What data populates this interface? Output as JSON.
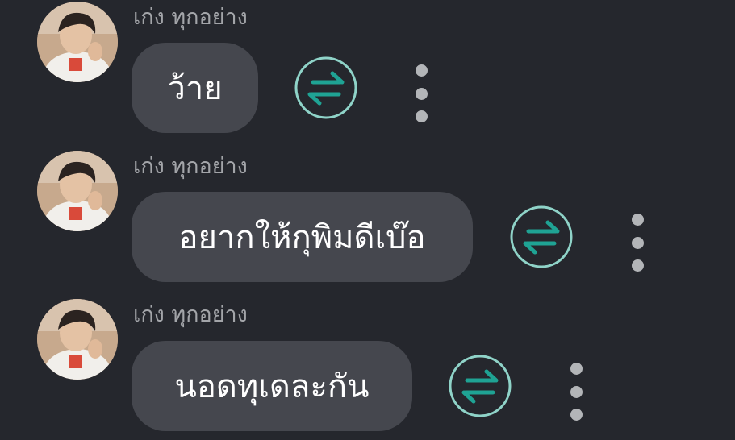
{
  "messages": [
    {
      "sender": "เก่ง ทุกอย่าง",
      "text": "ว้าย"
    },
    {
      "sender": "เก่ง ทุกอย่าง",
      "text": "อยากให้กุพิมดีเบ๊อ"
    },
    {
      "sender": "เก่ง ทุกอย่าง",
      "text": "นอดทุเดละกัน"
    }
  ],
  "icons": {
    "translate": "swap-arrows-icon",
    "more": "more-vertical-icon",
    "avatar": "user-avatar"
  },
  "colors": {
    "background": "#25272d",
    "bubble": "#45474e",
    "sender": "#a3a5a9",
    "accent_ring": "#8fd3c8",
    "accent_arrow": "#1fa394",
    "dots": "#b3b5b8"
  }
}
